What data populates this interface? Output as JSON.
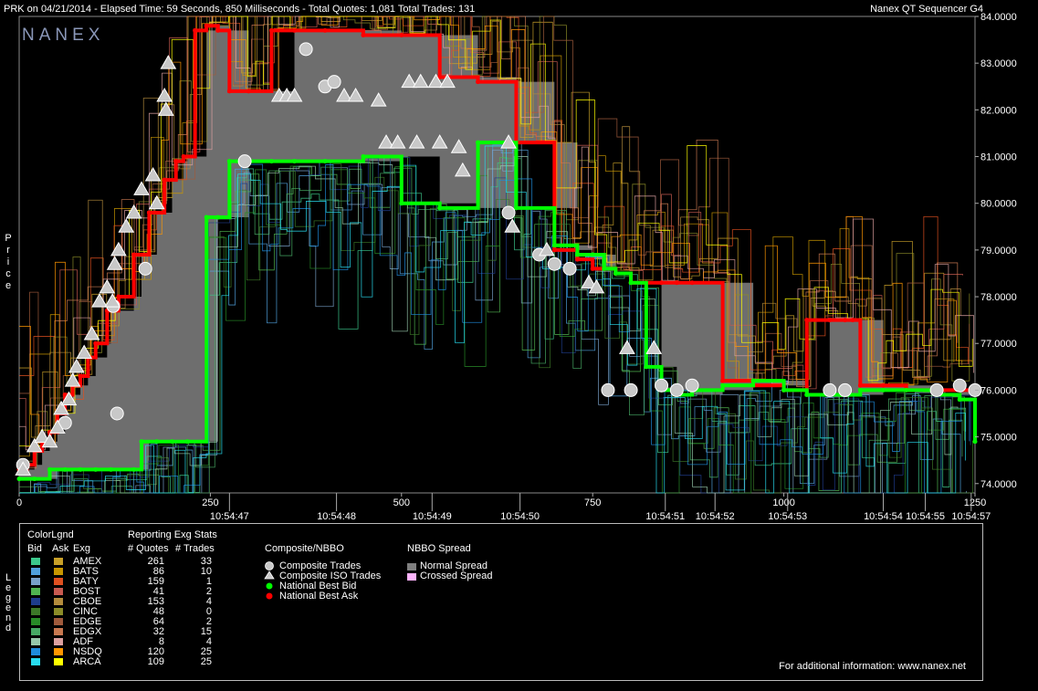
{
  "header": {
    "left": "PRK on 04/21/2014  -  Elapsed Time: 59 Seconds, 850 Milliseconds  -  Total Quotes: 1,081  Total Trades: 131",
    "right": "Nanex QT Sequencer G4"
  },
  "logo": "NANEX",
  "chart_data": {
    "type": "line",
    "title": "",
    "ylabel": "Price",
    "ylim": [
      73.8,
      84.0
    ],
    "xlim": [
      0,
      1250
    ],
    "y_ticks": [
      "74.0000",
      "75.0000",
      "76.0000",
      "77.0000",
      "78.0000",
      "79.0000",
      "80.0000",
      "81.0000",
      "82.0000",
      "83.0000",
      "84.0000"
    ],
    "x_ticks_seq": [
      "0",
      "250",
      "500",
      "750",
      "1000",
      "1250"
    ],
    "x_ticks_time": [
      {
        "label": "10:54:47",
        "x": 275
      },
      {
        "label": "10:54:48",
        "x": 415
      },
      {
        "label": "10:54:49",
        "x": 540
      },
      {
        "label": "10:54:50",
        "x": 655
      },
      {
        "label": "10:54:51",
        "x": 845
      },
      {
        "label": "10:54:52",
        "x": 910
      },
      {
        "label": "10:54:53",
        "x": 1005
      },
      {
        "label": "10:54:54",
        "x": 1130
      },
      {
        "label": "10:54:55",
        "x": 1185
      },
      {
        "label": "10:54:57",
        "x": 1245
      }
    ],
    "series": [
      {
        "name": "National Best Ask",
        "color": "#ff0000",
        "x": [
          0,
          10,
          20,
          30,
          40,
          50,
          60,
          70,
          80,
          90,
          100,
          115,
          130,
          150,
          170,
          190,
          205,
          215,
          230,
          245,
          260,
          275,
          300,
          330,
          360,
          400,
          450,
          500,
          550,
          600,
          650,
          700,
          730,
          750,
          765,
          780,
          800,
          820,
          840,
          860,
          880,
          920,
          960,
          1000,
          1030,
          1060,
          1080,
          1090,
          1100,
          1130,
          1160,
          1200,
          1230,
          1250
        ],
        "y": [
          74.3,
          74.4,
          74.7,
          74.9,
          75.1,
          75.5,
          75.9,
          76.1,
          76.3,
          76.7,
          77.0,
          77.7,
          78.0,
          78.9,
          79.8,
          80.5,
          80.9,
          81.0,
          83.7,
          83.8,
          83.7,
          82.4,
          82.4,
          83.7,
          83.7,
          83.7,
          83.6,
          83.6,
          82.7,
          82.6,
          81.3,
          79.0,
          78.8,
          78.6,
          78.6,
          78.5,
          78.3,
          78.3,
          78.3,
          78.3,
          78.3,
          76.2,
          76.1,
          76.0,
          77.5,
          77.5,
          77.5,
          77.5,
          76.1,
          76.1,
          76.0,
          76.0,
          76.0,
          76.0
        ]
      },
      {
        "name": "National Best Bid",
        "color": "#00ff00",
        "x": [
          0,
          20,
          40,
          60,
          80,
          100,
          120,
          150,
          160,
          180,
          200,
          220,
          245,
          260,
          275,
          300,
          330,
          360,
          400,
          450,
          500,
          550,
          600,
          650,
          700,
          730,
          750,
          765,
          780,
          800,
          820,
          840,
          860,
          880,
          920,
          960,
          1000,
          1030,
          1060,
          1080,
          1100,
          1130,
          1160,
          1200,
          1230,
          1250
        ],
        "y": [
          74.1,
          74.1,
          74.3,
          74.3,
          74.3,
          74.3,
          74.3,
          74.3,
          74.9,
          74.9,
          74.9,
          74.9,
          79.7,
          79.7,
          80.9,
          80.9,
          80.9,
          80.9,
          80.9,
          81.0,
          80.0,
          79.9,
          81.3,
          79.9,
          79.1,
          78.9,
          78.9,
          78.6,
          78.5,
          78.3,
          76.5,
          76.0,
          75.9,
          76.0,
          76.1,
          76.2,
          76.0,
          75.9,
          75.9,
          75.9,
          76.0,
          76.0,
          76.0,
          75.9,
          75.8,
          74.9
        ]
      }
    ],
    "trades": {
      "composite": [
        {
          "x": 5,
          "y": 74.4
        },
        {
          "x": 60,
          "y": 75.3
        },
        {
          "x": 123,
          "y": 77.8
        },
        {
          "x": 128,
          "y": 75.5
        },
        {
          "x": 165,
          "y": 78.6
        },
        {
          "x": 295,
          "y": 80.9
        },
        {
          "x": 375,
          "y": 83.3
        },
        {
          "x": 400,
          "y": 82.5
        },
        {
          "x": 412,
          "y": 82.6
        },
        {
          "x": 640,
          "y": 79.8
        },
        {
          "x": 680,
          "y": 78.9
        },
        {
          "x": 700,
          "y": 78.7
        },
        {
          "x": 720,
          "y": 78.6
        },
        {
          "x": 770,
          "y": 76.0
        },
        {
          "x": 800,
          "y": 76.0
        },
        {
          "x": 840,
          "y": 76.1
        },
        {
          "x": 860,
          "y": 76.0
        },
        {
          "x": 880,
          "y": 76.1
        },
        {
          "x": 1060,
          "y": 76.0
        },
        {
          "x": 1080,
          "y": 76.0
        },
        {
          "x": 1200,
          "y": 76.0
        },
        {
          "x": 1250,
          "y": 76.0
        },
        {
          "x": 1230,
          "y": 76.1
        }
      ],
      "iso": [
        {
          "x": 5,
          "y": 74.3
        },
        {
          "x": 20,
          "y": 74.8
        },
        {
          "x": 30,
          "y": 75.0
        },
        {
          "x": 40,
          "y": 74.9
        },
        {
          "x": 50,
          "y": 75.2
        },
        {
          "x": 55,
          "y": 75.6
        },
        {
          "x": 65,
          "y": 75.8
        },
        {
          "x": 70,
          "y": 76.2
        },
        {
          "x": 75,
          "y": 76.5
        },
        {
          "x": 85,
          "y": 76.8
        },
        {
          "x": 95,
          "y": 77.2
        },
        {
          "x": 105,
          "y": 77.9
        },
        {
          "x": 115,
          "y": 78.2
        },
        {
          "x": 122,
          "y": 77.9
        },
        {
          "x": 125,
          "y": 78.7
        },
        {
          "x": 130,
          "y": 79.0
        },
        {
          "x": 140,
          "y": 79.5
        },
        {
          "x": 150,
          "y": 79.8
        },
        {
          "x": 160,
          "y": 80.3
        },
        {
          "x": 175,
          "y": 80.6
        },
        {
          "x": 180,
          "y": 80.0
        },
        {
          "x": 190,
          "y": 82.3
        },
        {
          "x": 192,
          "y": 82.0
        },
        {
          "x": 195,
          "y": 83.0
        },
        {
          "x": 340,
          "y": 82.3
        },
        {
          "x": 350,
          "y": 82.3
        },
        {
          "x": 360,
          "y": 82.3
        },
        {
          "x": 425,
          "y": 82.3
        },
        {
          "x": 440,
          "y": 82.3
        },
        {
          "x": 470,
          "y": 82.2
        },
        {
          "x": 510,
          "y": 82.6
        },
        {
          "x": 525,
          "y": 82.6
        },
        {
          "x": 545,
          "y": 82.6
        },
        {
          "x": 560,
          "y": 82.6
        },
        {
          "x": 480,
          "y": 81.3
        },
        {
          "x": 495,
          "y": 81.3
        },
        {
          "x": 520,
          "y": 81.3
        },
        {
          "x": 550,
          "y": 81.3
        },
        {
          "x": 575,
          "y": 81.2
        },
        {
          "x": 580,
          "y": 80.7
        },
        {
          "x": 640,
          "y": 81.3
        },
        {
          "x": 645,
          "y": 79.5
        },
        {
          "x": 690,
          "y": 79.0
        },
        {
          "x": 745,
          "y": 78.3
        },
        {
          "x": 755,
          "y": 78.2
        },
        {
          "x": 795,
          "y": 76.9
        },
        {
          "x": 830,
          "y": 76.9
        }
      ]
    }
  },
  "legend": {
    "title": "Legend",
    "color_legend_title": "ColorLgnd",
    "col_bid": "Bid",
    "col_ask": "Ask",
    "col_exg": "Exg",
    "stats_title": "Reporting Exg Stats",
    "col_quotes": "# Quotes",
    "col_trades": "# Trades",
    "exchanges": [
      {
        "name": "AMEX",
        "quotes": "261",
        "trades": "33",
        "bid": "#3cc88c",
        "ask": "#c8a028"
      },
      {
        "name": "BATS",
        "quotes": "86",
        "trades": "10",
        "bid": "#50a0dc",
        "ask": "#c89600"
      },
      {
        "name": "BATY",
        "quotes": "159",
        "trades": "1",
        "bid": "#78a0c8",
        "ask": "#e05020"
      },
      {
        "name": "BOST",
        "quotes": "41",
        "trades": "2",
        "bid": "#50b450",
        "ask": "#c85a50"
      },
      {
        "name": "CBOE",
        "quotes": "153",
        "trades": "4",
        "bid": "#1e3c8c",
        "ask": "#b48c3c"
      },
      {
        "name": "CINC",
        "quotes": "48",
        "trades": "0",
        "bid": "#3c7828",
        "ask": "#8c8c28"
      },
      {
        "name": "EDGE",
        "quotes": "64",
        "trades": "2",
        "bid": "#288c28",
        "ask": "#a05a3c"
      },
      {
        "name": "EDGX",
        "quotes": "32",
        "trades": "15",
        "bid": "#46aa64",
        "ask": "#c87850"
      },
      {
        "name": "ADF",
        "quotes": "8",
        "trades": "4",
        "bid": "#96c8aa",
        "ask": "#dca0a0"
      },
      {
        "name": "NSDQ",
        "quotes": "120",
        "trades": "25",
        "bid": "#1e8cdc",
        "ask": "#ff9600"
      },
      {
        "name": "ARCA",
        "quotes": "109",
        "trades": "25",
        "bid": "#28dcf0",
        "ask": "#ffff00"
      }
    ],
    "nbbo_title": "Composite/NBBO",
    "nbbo_items": [
      "Composite Trades",
      "Composite ISO Trades",
      "National Best Bid",
      "National Best Ask"
    ],
    "spread_title": "NBBO Spread",
    "spread_items": [
      {
        "label": "Normal Spread",
        "color": "#808080"
      },
      {
        "label": "Crossed Spread",
        "color": "#ffb4ff"
      }
    ],
    "footer": "For additional information: www.nanex.net"
  }
}
